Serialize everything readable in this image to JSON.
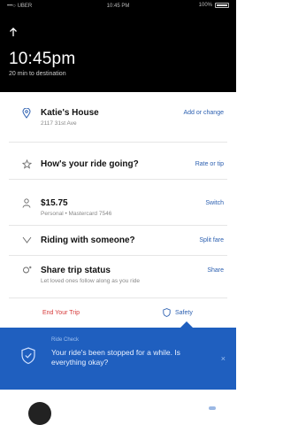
{
  "status_bar": {
    "carrier": "•••○ UBER",
    "time": "10:45 PM",
    "battery": "100%"
  },
  "header": {
    "eta_time": "10:45pm",
    "eta_subtitle": "20 min to destination"
  },
  "rows": [
    {
      "title": "Katie's House",
      "subtitle": "2117 31st Ave",
      "action": "Add or change",
      "icon": "location-pin-icon"
    },
    {
      "title": "How's your ride going?",
      "subtitle": "",
      "action": "Rate or tip",
      "icon": "star-icon"
    },
    {
      "title": "$15.75",
      "subtitle": "Personal • Mastercard 7546",
      "action": "Switch",
      "icon": "person-icon"
    },
    {
      "title": "Riding with someone?",
      "subtitle": "",
      "action": "Split fare",
      "icon": "split-icon"
    },
    {
      "title": "Share trip status",
      "subtitle": "Let loved ones follow along as you ride",
      "action": "Share",
      "icon": "share-icon"
    }
  ],
  "end_trip_label": "End Your Trip",
  "safety_label": "Safety",
  "ride_check": {
    "label": "Ride Check",
    "message": "Your ride's been stopped for a while. Is everything okay?",
    "close": "×"
  },
  "colors": {
    "accent": "#2b5fb0",
    "danger": "#d63a3a",
    "banner": "#1f5fbf",
    "header": "#000000"
  }
}
